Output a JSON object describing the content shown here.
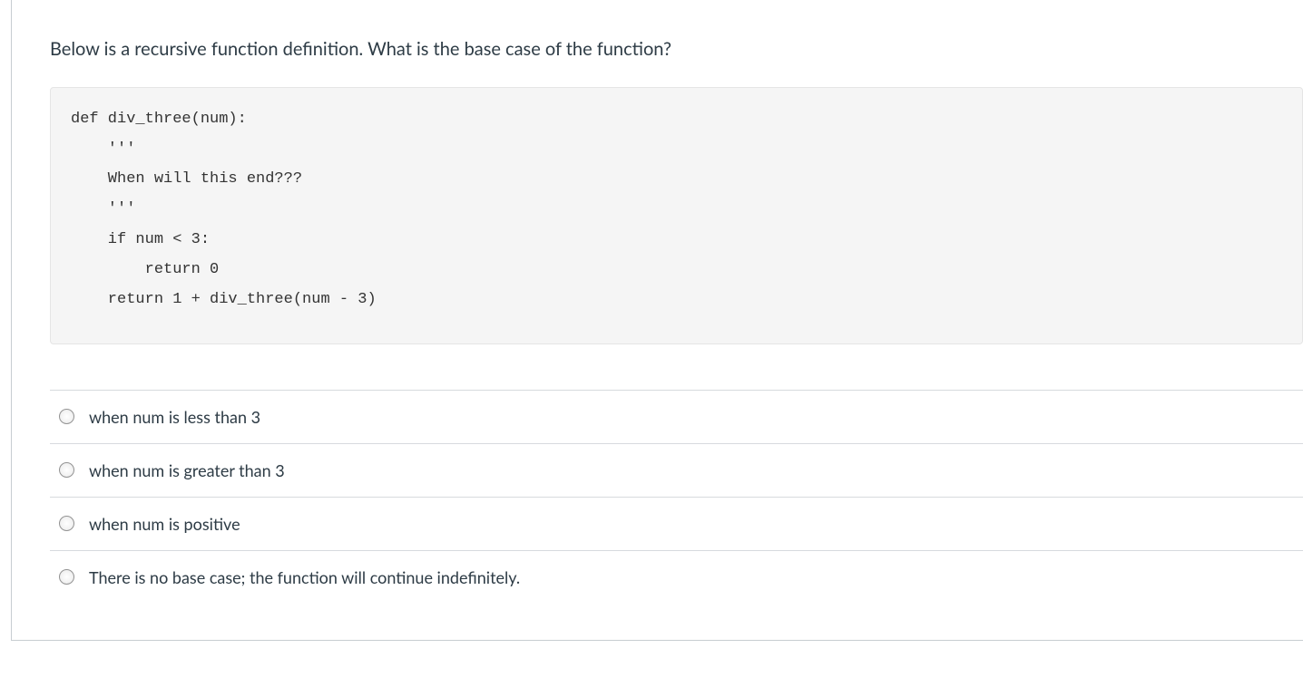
{
  "question": {
    "prompt": "Below is a recursive function definition. What is the base case of the function?",
    "code": "def div_three(num):\n    '''\n    When will this end???\n    '''\n    if num < 3:\n        return 0\n    return 1 + div_three(num - 3)"
  },
  "answers": [
    {
      "label": "when num is less than 3"
    },
    {
      "label": "when num is greater than 3"
    },
    {
      "label": "when num is positive"
    },
    {
      "label": "There is no base case; the function will continue indefinitely."
    }
  ]
}
